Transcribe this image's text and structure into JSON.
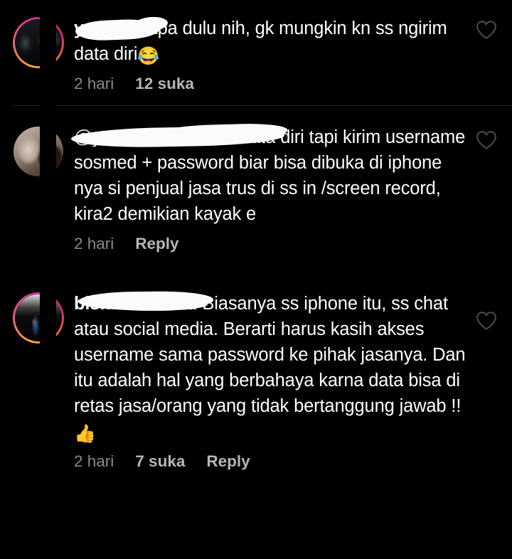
{
  "screen": {
    "name": "instagram-comments",
    "background_color": "#000000",
    "text_color": "#ffffff",
    "meta_color": "#8a8a8a",
    "accent_color": "#b6b6b6"
  },
  "comments": [
    {
      "id": "comment-1",
      "username": "yovie",
      "username_redacted": true,
      "avatar": {
        "name": "avatar-yovie",
        "has_story_ring": true,
        "ring_colors": [
          "#fcaf45",
          "#f47133",
          "#d62976",
          "#cf2aa0"
        ]
      },
      "text_before_emoji": " ss apa dulu nih, gk mungkin kn ss ngirim data diri",
      "emoji": "😂",
      "emoji_name": "face-with-tears-of-joy",
      "full_text": "yovie ss apa dulu nih, gk mungkin kn ss ngirim data diri😂",
      "meta": {
        "time": "2 hari",
        "likes": "12 suka",
        "reply": null
      },
      "like_icon": "heart-outline-icon",
      "liked": false
    },
    {
      "id": "comment-2",
      "username": "",
      "username_redacted": true,
      "mention": "@yovie_",
      "mention_redacted": true,
      "avatar": {
        "name": "avatar-commenter-2",
        "has_story_ring": false,
        "ring_colors": []
      },
      "text_before_emoji": "bukan kirim data diri tapi kirim username sosmed + password biar bisa dibuka di iphone nya si penjual jasa trus di ss in /screen record, kira2 demikian kayak e",
      "emoji": null,
      "emoji_name": null,
      "full_text": "@yovie_ bukan kirim data diri tapi kirim username sosmed + password biar bisa dibuka di iphone nya si penjual jasa trus di ss in /screen record, kira2 demikian kayak e",
      "meta": {
        "time": "2 hari",
        "likes": null,
        "reply": "Reply"
      },
      "like_icon": "heart-outline-icon",
      "liked": false
    },
    {
      "id": "comment-3",
      "username": "bisnismillenial",
      "username_redacted": true,
      "avatar": {
        "name": "avatar-bisnismillenial",
        "has_story_ring": true,
        "ring_colors": [
          "#f47133",
          "#d62976",
          "#cf2aa0"
        ]
      },
      "text_before_emoji": " Biasanya ss iphone itu, ss chat atau social media. Berarti harus kasih akses username sama password ke pihak jasanya. Dan itu adalah hal yang berbahaya karna data bisa di retas jasa/orang yang tidak bertanggung jawab !! ",
      "emoji": "👍",
      "emoji_name": "thumbs-up",
      "full_text": "bisnismillenial Biasanya ss iphone itu, ss chat atau social media. Berarti harus kasih akses username sama password ke pihak jasanya. Dan itu adalah hal yang berbahaya karna data bisa di retas jasa/orang yang tidak bertanggung jawab !! 👍",
      "meta": {
        "time": "2 hari",
        "likes": "7 suka",
        "reply": "Reply"
      },
      "like_icon": "heart-outline-icon",
      "liked": false
    }
  ]
}
